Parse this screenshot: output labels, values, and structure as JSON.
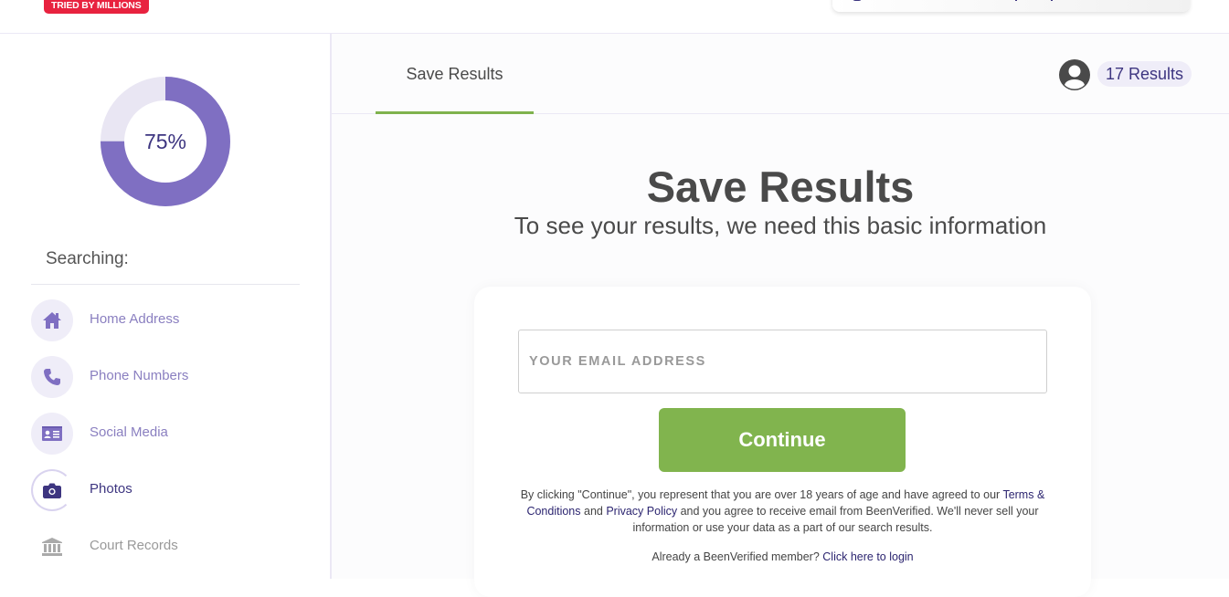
{
  "header": {
    "badge": "TRIED BY MILLIONS"
  },
  "sidebar": {
    "progress": {
      "percent": 75,
      "label": "75%",
      "fill_color": "#7f6fc2",
      "track_color": "#e9e6f3"
    },
    "searching_label": "Searching:",
    "items": [
      {
        "label": "Home Address",
        "icon": "home-icon",
        "state": "done"
      },
      {
        "label": "Phone Numbers",
        "icon": "phone-icon",
        "state": "done"
      },
      {
        "label": "Social Media",
        "icon": "id-card-icon",
        "state": "done"
      },
      {
        "label": "Photos",
        "icon": "camera-icon",
        "state": "active"
      },
      {
        "label": "Court Records",
        "icon": "courthouse-icon",
        "state": "pending"
      }
    ]
  },
  "main": {
    "tab_label": "Save Results",
    "results_count": "17 Results",
    "title": "Save Results",
    "subtitle": "To see your results, we need this basic information",
    "form": {
      "email_placeholder": "YOUR EMAIL ADDRESS",
      "email_value": "",
      "continue_label": "Continue",
      "legal_prefix": "By clicking \"Continue\", you represent that you are over 18 years of age and have agreed to our ",
      "terms_link": "Terms & Conditions",
      "legal_and": " and ",
      "privacy_link": "Privacy Policy",
      "legal_suffix": " and you agree to receive email from BeenVerified. We'll never sell your information or use your data as a part of our search results.",
      "login_prompt": "Already a BeenVerified member? ",
      "login_link": "Click here to login"
    }
  },
  "colors": {
    "accent_green": "#81b44e",
    "brand_purple": "#3d3580",
    "badge_red": "#e8223f"
  }
}
